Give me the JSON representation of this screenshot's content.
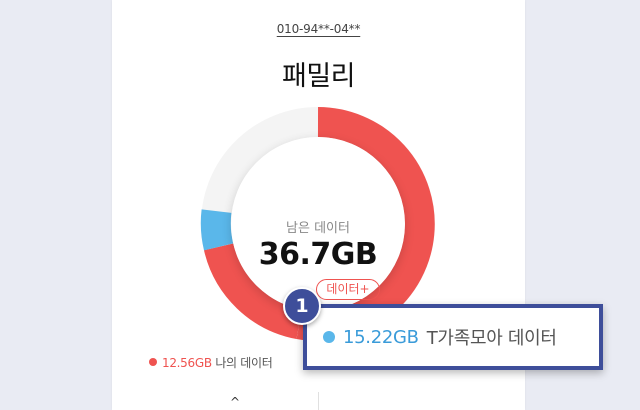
{
  "header": {
    "phone_number": "010-94**-04**",
    "plan_name": "패밀리"
  },
  "donut": {
    "remaining_label": "남은 데이터",
    "remaining_value": "36.7GB",
    "add_data_button": "데이터+",
    "colors": {
      "used_red": "#ef5350",
      "family_blue": "#5ab7ea",
      "empty_gray": "#f4f4f4"
    }
  },
  "legend": {
    "my_data_amount": "12.56GB",
    "my_data_label": "나의 데이터"
  },
  "callout": {
    "step_number": "1",
    "family_data_amount": "15.22GB",
    "family_data_label": "T가족모아 데이터"
  },
  "footer": {
    "caret": "^"
  }
}
